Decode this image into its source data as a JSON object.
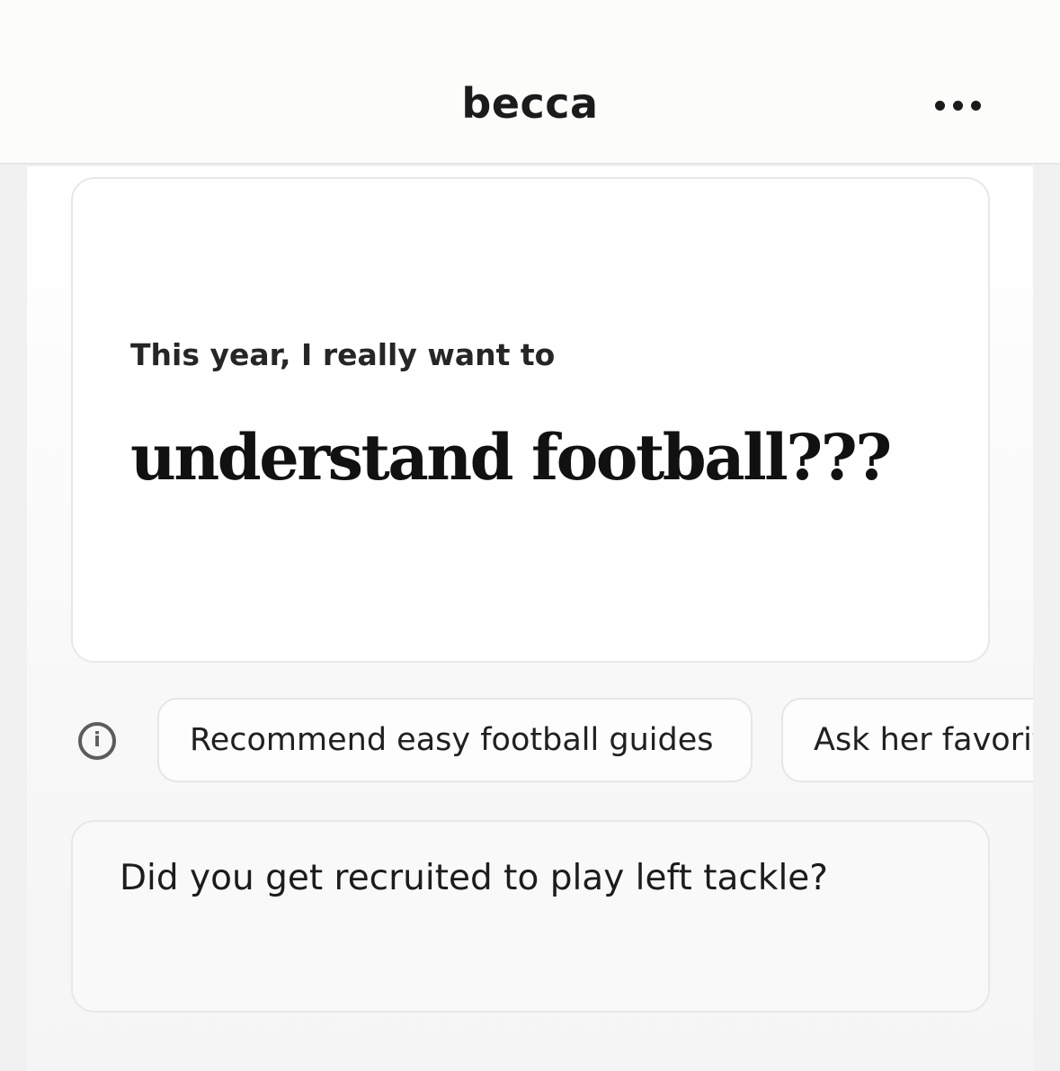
{
  "header": {
    "title": "becca",
    "more_icon": "more-horizontal-icon"
  },
  "prompt_card": {
    "label": "This year, I really want to",
    "answer": "understand football???"
  },
  "suggestions": {
    "info_icon": "info-icon",
    "info_glyph": "i",
    "chips": [
      {
        "label": "Recommend easy football guides"
      },
      {
        "label": "Ask her favorite"
      }
    ]
  },
  "reply": {
    "value": "Did you get recruited to play left tackle?"
  }
}
